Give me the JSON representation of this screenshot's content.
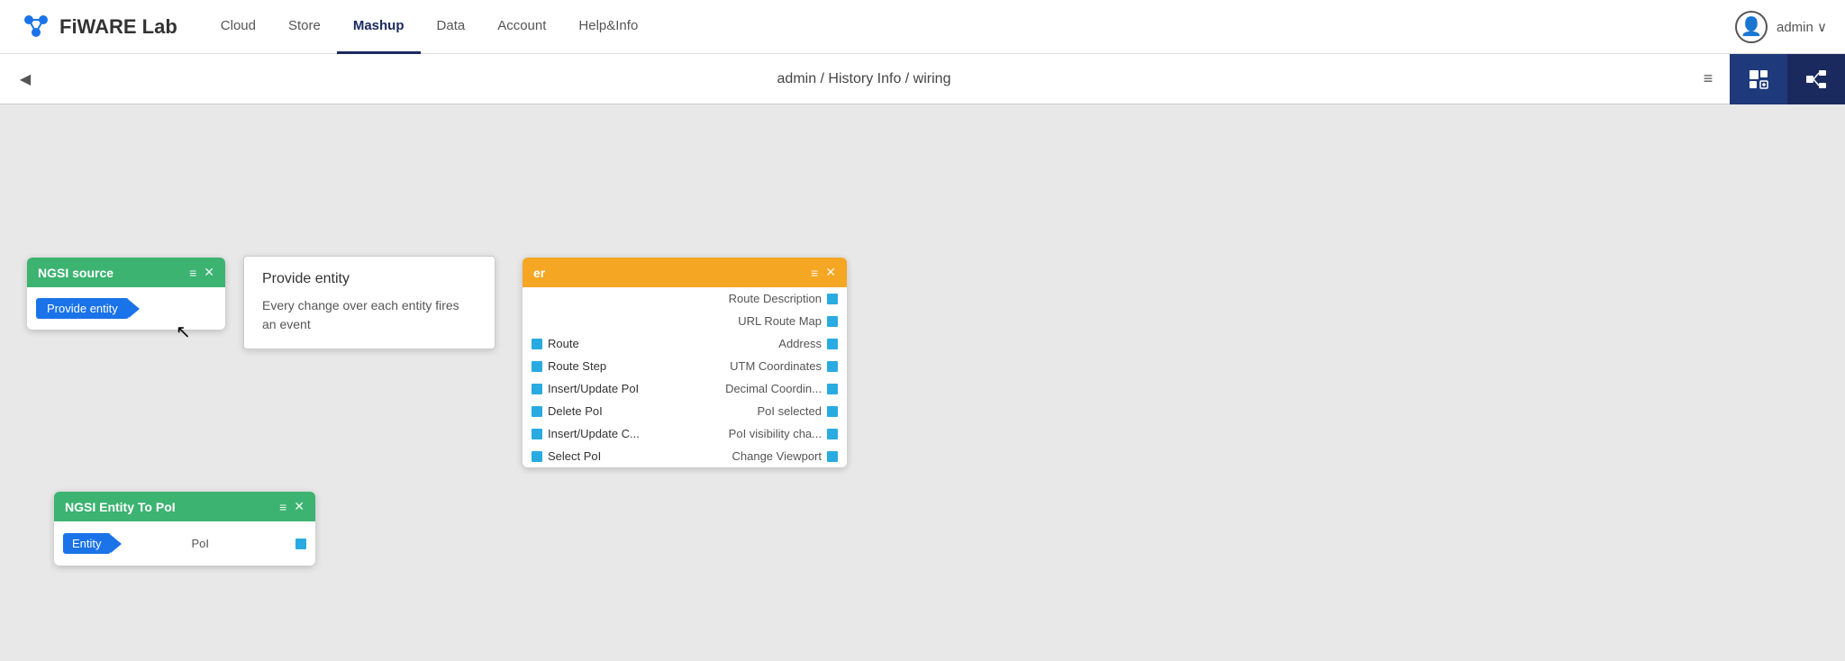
{
  "nav": {
    "logo_text": "FiWARE Lab",
    "items": [
      {
        "label": "Cloud",
        "active": false
      },
      {
        "label": "Store",
        "active": false
      },
      {
        "label": "Mashup",
        "active": true
      },
      {
        "label": "Data",
        "active": false
      },
      {
        "label": "Account",
        "active": false
      },
      {
        "label": "Help&Info",
        "active": false
      }
    ],
    "user_label": "admin ∨"
  },
  "breadcrumb": {
    "path": "admin / History Info / wiring"
  },
  "ngsi_source": {
    "title": "NGSI source",
    "port_label": "Provide entity"
  },
  "tooltip": {
    "title": "Provide entity",
    "body_line1": "Every change over each entity fires",
    "body_line2": "an event"
  },
  "route_widget": {
    "title": "er",
    "ports": [
      {
        "in": "",
        "out": "Route Description"
      },
      {
        "in": "",
        "out": "URL Route Map"
      },
      {
        "in": "Route",
        "out": "Address"
      },
      {
        "in": "Route Step",
        "out": "UTM Coordinates"
      },
      {
        "in": "Insert/Update PoI",
        "out": "Decimal Coordin..."
      },
      {
        "in": "Delete PoI",
        "out": "PoI selected"
      },
      {
        "in": "Insert/Update C...",
        "out": "PoI visibility cha..."
      },
      {
        "in": "Select PoI",
        "out": "Change Viewport"
      }
    ]
  },
  "entity_widget": {
    "title": "NGSI Entity To PoI",
    "port_in_label": "Entity",
    "port_out_label": "PoI"
  },
  "icons": {
    "collapse": "◀",
    "menu_lines": "≡",
    "close": "✕",
    "add_widget": "⊞",
    "diagram": "⊞",
    "user": "👤",
    "cursor": "↖"
  }
}
